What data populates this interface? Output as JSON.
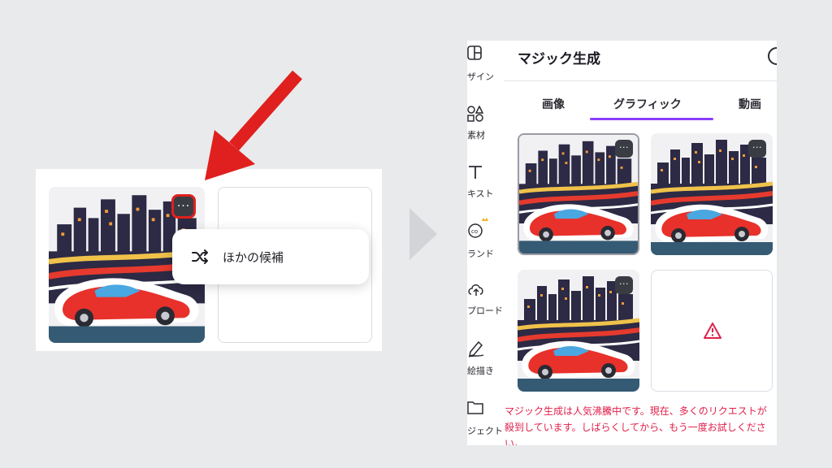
{
  "left_preview": {
    "more_button_label": "···",
    "menu_item_label": "ほかの候補",
    "shuffle_icon": "shuffle-icon"
  },
  "right_panel": {
    "title": "マジック生成",
    "rail": [
      {
        "label": "ザイン",
        "icon": "layout-icon"
      },
      {
        "label": "素材",
        "icon": "shapes-icon"
      },
      {
        "label": "キスト",
        "icon": "text-icon"
      },
      {
        "label": "ランド",
        "icon": "brand-icon"
      },
      {
        "label": "プロード",
        "icon": "cloud-upload-icon"
      },
      {
        "label": "絵描き",
        "icon": "pen-icon"
      },
      {
        "label": "ジェクト",
        "icon": "folder-icon"
      }
    ],
    "tabs": [
      {
        "label": "画像"
      },
      {
        "label": "グラフィック",
        "active": true
      },
      {
        "label": "動画"
      }
    ],
    "more_button_label": "···",
    "error_message": "マジック生成は人気沸騰中です。現在、多くのリクエストが殺到しています。しばらくしてから、もう一度お試しください。",
    "colors": {
      "accent": "#8b3dff",
      "error": "#e0204a",
      "highlight": "#e0201e"
    }
  }
}
